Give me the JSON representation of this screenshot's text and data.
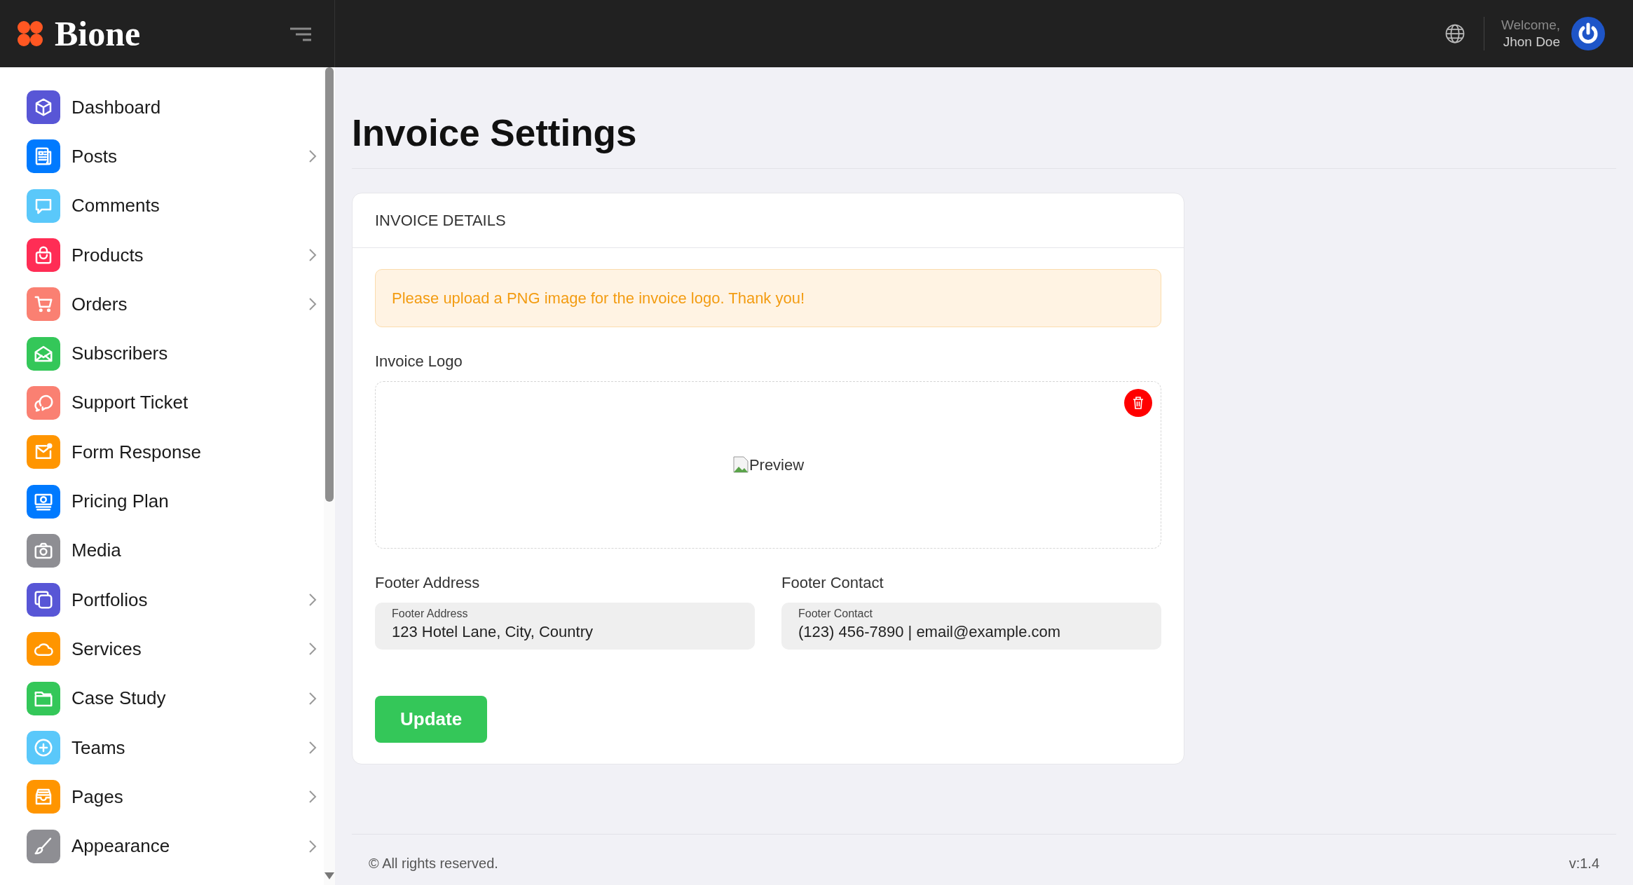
{
  "header": {
    "brand": "Bione",
    "welcome": "Welcome,",
    "user_name": "Jhon Doe"
  },
  "sidebar": {
    "items": [
      {
        "label": "Dashboard",
        "color": "#5856d6",
        "expandable": false
      },
      {
        "label": "Posts",
        "color": "#007aff",
        "expandable": true
      },
      {
        "label": "Comments",
        "color": "#5ac8fa",
        "expandable": false
      },
      {
        "label": "Products",
        "color": "#ff2d55",
        "expandable": true
      },
      {
        "label": "Orders",
        "color": "#fa8072",
        "expandable": true
      },
      {
        "label": "Subscribers",
        "color": "#34c759",
        "expandable": false
      },
      {
        "label": "Support Ticket",
        "color": "#fa8072",
        "expandable": false
      },
      {
        "label": "Form Response",
        "color": "#ff9500",
        "expandable": false
      },
      {
        "label": "Pricing Plan",
        "color": "#007aff",
        "expandable": false
      },
      {
        "label": "Media",
        "color": "#8e8e93",
        "expandable": false
      },
      {
        "label": "Portfolios",
        "color": "#5856d6",
        "expandable": true
      },
      {
        "label": "Services",
        "color": "#ff9500",
        "expandable": true
      },
      {
        "label": "Case Study",
        "color": "#34c759",
        "expandable": true
      },
      {
        "label": "Teams",
        "color": "#5ac8fa",
        "expandable": true
      },
      {
        "label": "Pages",
        "color": "#ff9500",
        "expandable": true
      },
      {
        "label": "Appearance",
        "color": "#8e8e93",
        "expandable": true
      }
    ]
  },
  "page": {
    "title": "Invoice Settings"
  },
  "card": {
    "header": "INVOICE DETAILS",
    "alert": "Please upload a PNG image for the invoice logo. Thank you!",
    "logo_label": "Invoice Logo",
    "preview_alt": "Preview",
    "fields": [
      {
        "label": "Footer Address",
        "floating_label": "Footer Address",
        "value": "123 Hotel Lane, City, Country"
      },
      {
        "label": "Footer Contact",
        "floating_label": "Footer Contact",
        "value": "(123) 456-7890 | email@example.com"
      }
    ],
    "button": "Update"
  },
  "footer": {
    "copyright": "© All rights reserved.",
    "version": "v:1.4"
  }
}
